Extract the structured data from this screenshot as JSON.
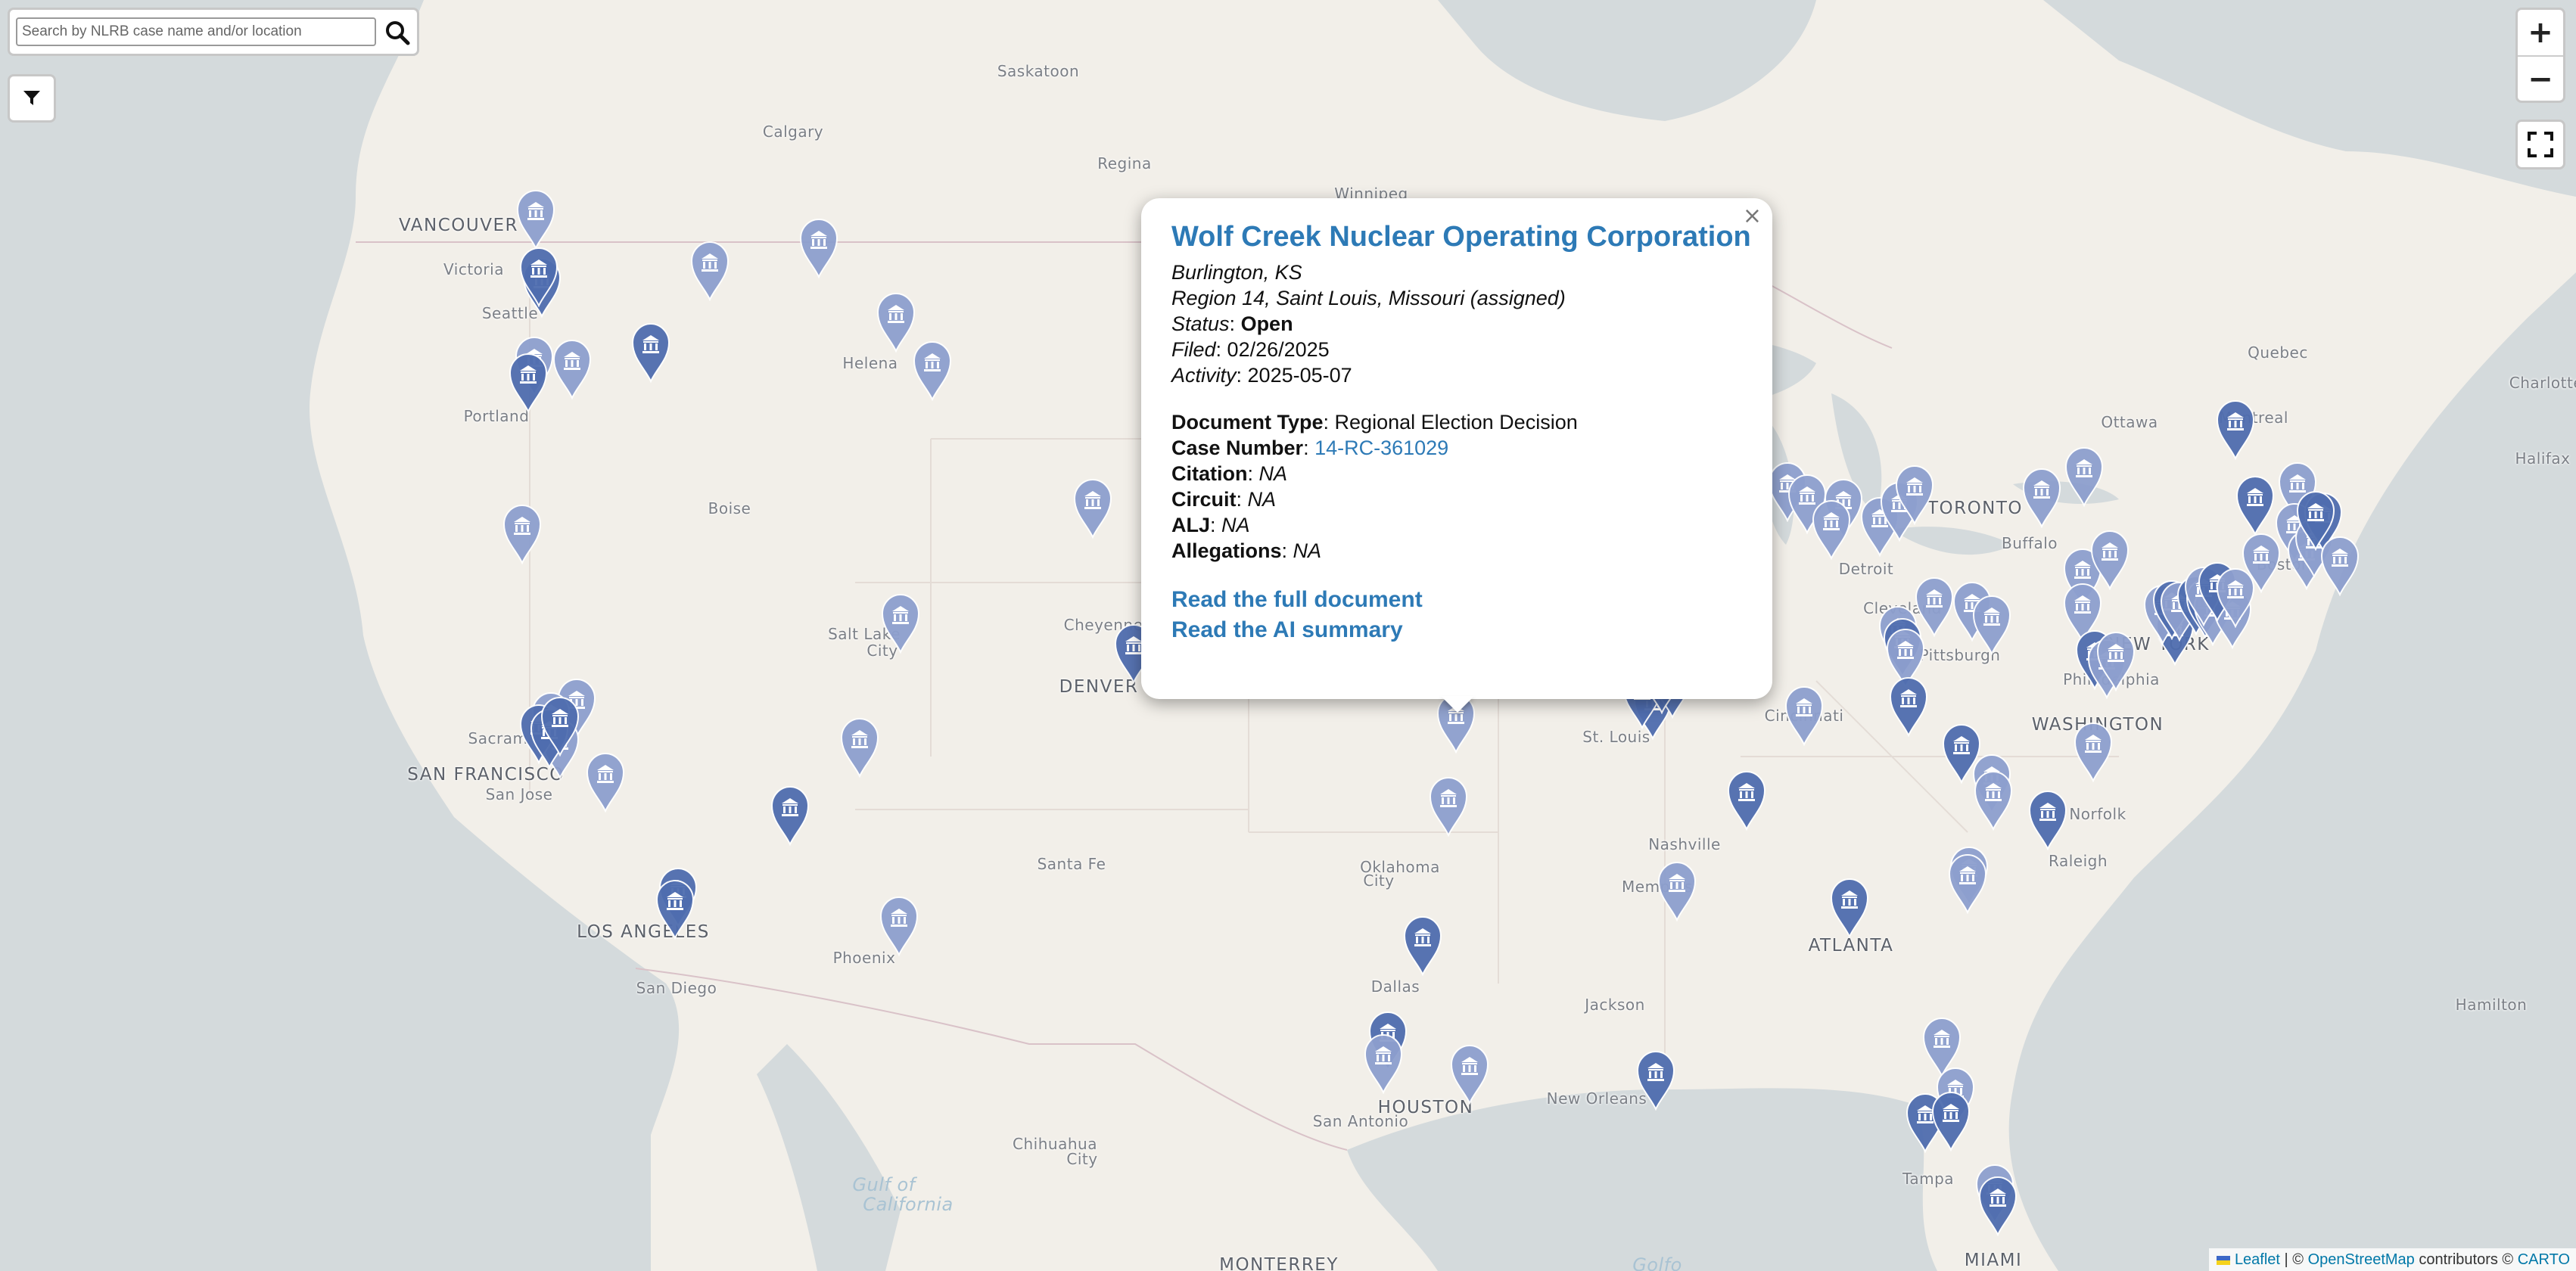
{
  "search": {
    "placeholder": "Search by NLRB case name and/or location"
  },
  "zoom": {
    "in_label": "+",
    "out_label": "−"
  },
  "attribution": {
    "leaflet": "Leaflet",
    "sep": " | © ",
    "osm": "OpenStreetMap",
    "rest": " contributors © ",
    "carto": "CARTO"
  },
  "colors": {
    "marker_light": "#8d9fce",
    "marker_dark": "#4f6daf",
    "link": "#2d7ab6",
    "water": "#d4dadc",
    "land": "#f2efe9"
  },
  "popup": {
    "title": "Wolf Creek Nuclear Operating Corporation",
    "location": "Burlington, KS",
    "region": "Region 14, Saint Louis, Missouri (assigned)",
    "status_label": "Status",
    "status_value": "Open",
    "filed_label": "Filed",
    "filed_value": "02/26/2025",
    "activity_label": "Activity",
    "activity_value": "2025-05-07",
    "doctype_label": "Document Type",
    "doctype_value": "Regional Election Decision",
    "case_label": "Case Number",
    "case_value": "14-RC-361029",
    "citation_label": "Citation",
    "citation_value": "NA",
    "circuit_label": "Circuit",
    "circuit_value": "NA",
    "alj_label": "ALJ",
    "alj_value": "NA",
    "allegations_label": "Allegations",
    "allegations_value": "NA",
    "read_doc": "Read the full document",
    "read_ai": "Read the AI summary",
    "close": "×"
  },
  "cities": [
    {
      "name": "Saskatoon",
      "big": false
    },
    {
      "name": "Calgary",
      "big": false
    },
    {
      "name": "Regina",
      "big": false
    },
    {
      "name": "Winnipeg",
      "big": false
    },
    {
      "name": "VANCOUVER",
      "big": true
    },
    {
      "name": "Victoria",
      "big": false
    },
    {
      "name": "Seattle",
      "big": false
    },
    {
      "name": "Portland",
      "big": false
    },
    {
      "name": "Helena",
      "big": false
    },
    {
      "name": "Boise",
      "big": false
    },
    {
      "name": "Salt Lake",
      "big": false
    },
    {
      "name": "City",
      "big": false
    },
    {
      "name": "Cheyenne",
      "big": false
    },
    {
      "name": "DENVER",
      "big": true
    },
    {
      "name": "Sacram",
      "big": false
    },
    {
      "name": "SAN FRANCISCO",
      "big": true
    },
    {
      "name": "San Jose",
      "big": false
    },
    {
      "name": "LOS ANGELES",
      "big": true
    },
    {
      "name": "San Diego",
      "big": false
    },
    {
      "name": "Phoenix",
      "big": false
    },
    {
      "name": "Santa Fe",
      "big": false
    },
    {
      "name": "Oklahoma",
      "big": false
    },
    {
      "name": "City",
      "big": false
    },
    {
      "name": "Dallas",
      "big": false
    },
    {
      "name": "HOUSTON",
      "big": true
    },
    {
      "name": "San Antonio",
      "big": false
    },
    {
      "name": "Chihuahua",
      "big": false
    },
    {
      "name": "City",
      "big": false
    },
    {
      "name": "MONTERREY",
      "big": true
    },
    {
      "name": "Memphis",
      "big": false
    },
    {
      "name": "Jackson",
      "big": false
    },
    {
      "name": "New Orleans",
      "big": false
    },
    {
      "name": "St. Louis",
      "big": false
    },
    {
      "name": "Nashville",
      "big": false
    },
    {
      "name": "ATLANTA",
      "big": true
    },
    {
      "name": "Tampa",
      "big": false
    },
    {
      "name": "MIAMI",
      "big": true
    },
    {
      "name": "Cincinnati",
      "big": false
    },
    {
      "name": "Cleveland",
      "big": false
    },
    {
      "name": "Pittsburgh",
      "big": false
    },
    {
      "name": "Detroit",
      "big": false
    },
    {
      "name": "TORONTO",
      "big": true
    },
    {
      "name": "Buffalo",
      "big": false
    },
    {
      "name": "Ottawa",
      "big": false
    },
    {
      "name": "Montreal",
      "big": false
    },
    {
      "name": "Quebec",
      "big": false
    },
    {
      "name": "Charlottetown",
      "big": false
    },
    {
      "name": "Halifax",
      "big": false
    },
    {
      "name": "Hamilton",
      "big": false
    },
    {
      "name": "WASHINGTON",
      "big": true
    },
    {
      "name": "Norfolk",
      "big": false
    },
    {
      "name": "Raleigh",
      "big": false
    },
    {
      "name": "Philadelphia",
      "big": false
    },
    {
      "name": "NEW YORK",
      "big": true
    },
    {
      "name": "Boston",
      "big": false
    }
  ],
  "water_labels": [
    "Gulf of",
    "California",
    "Golfo"
  ]
}
